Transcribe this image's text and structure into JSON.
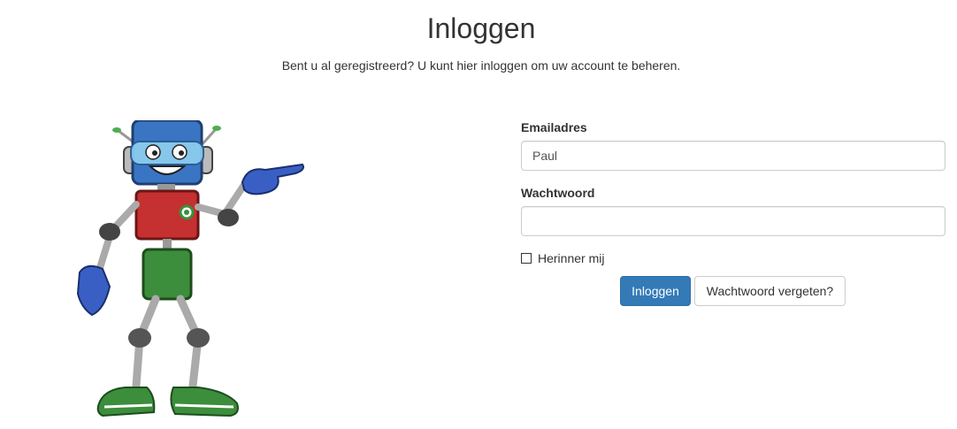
{
  "header": {
    "title": "Inloggen",
    "subtitle": "Bent u al geregistreerd? U kunt hier inloggen om uw account te beheren."
  },
  "illustration": {
    "name": "robot-mascot"
  },
  "form": {
    "email_label": "Emailadres",
    "email_value": "Paul",
    "password_label": "Wachtwoord",
    "password_value": "",
    "remember_label": "Herinner mij",
    "remember_checked": false,
    "login_button": "Inloggen",
    "forgot_button": "Wachtwoord vergeten?"
  },
  "colors": {
    "primary": "#337ab7",
    "text": "#333333",
    "border": "#cccccc"
  }
}
